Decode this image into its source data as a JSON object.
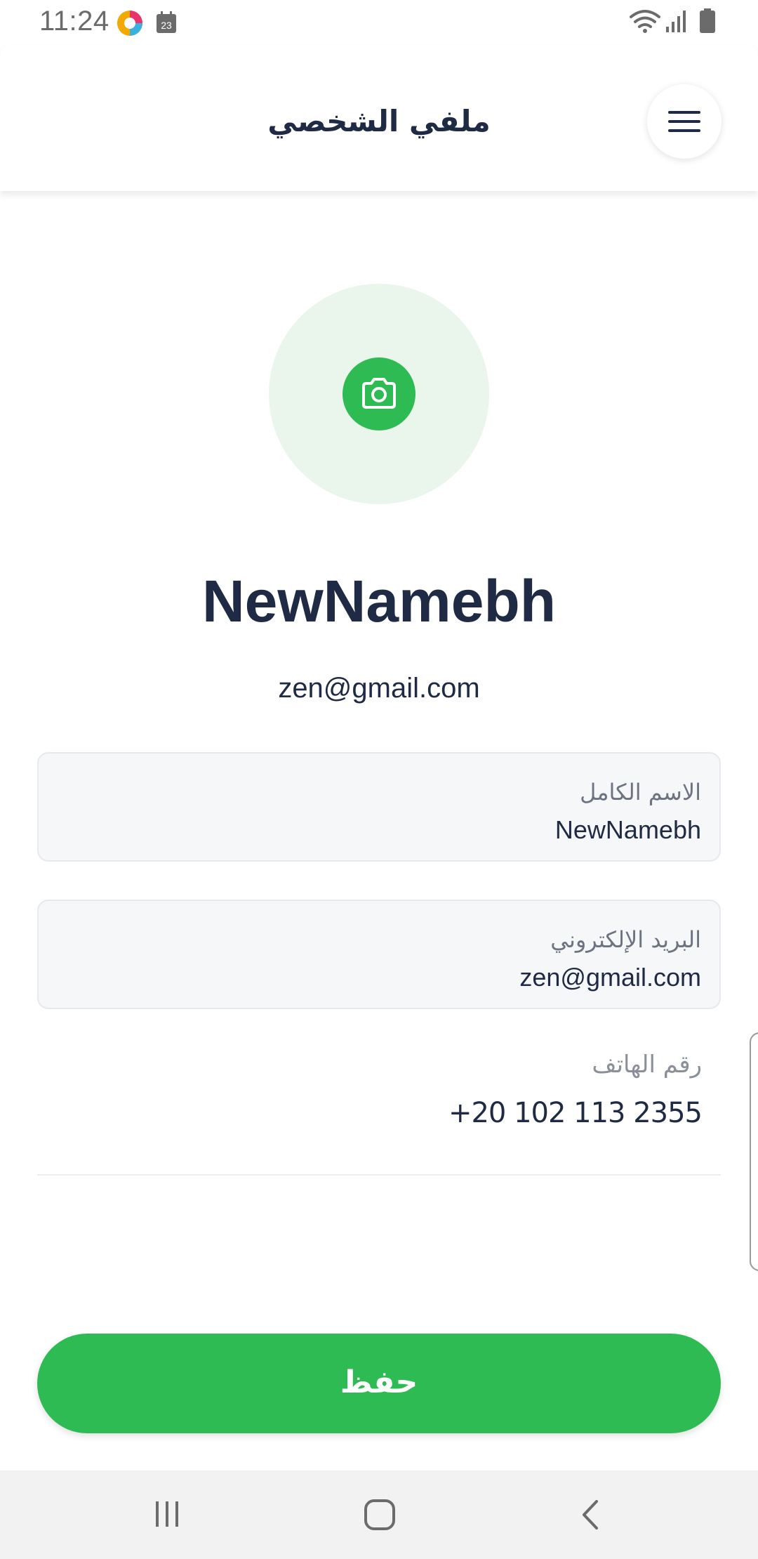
{
  "status_bar": {
    "time": "11:24",
    "calendar_day": "23"
  },
  "header": {
    "title": "ملفي الشخصي"
  },
  "profile": {
    "name": "NewNamebh",
    "email": "zen@gmail.com"
  },
  "fields": {
    "full_name": {
      "label": "الاسم الكامل",
      "value": "NewNamebh"
    },
    "email": {
      "label": "البريد الإلكتروني",
      "value": "zen@gmail.com"
    },
    "phone": {
      "label": "رقم الهاتف",
      "value": "+20 102 113 2355"
    }
  },
  "actions": {
    "save_label": "حفظ"
  },
  "colors": {
    "primary_green": "#2fbb54",
    "avatar_bg": "#eaf6ec",
    "text_dark": "#1f2a44",
    "field_bg": "#f6f7f9"
  },
  "icons": {
    "menu": "hamburger-icon",
    "camera": "camera-icon",
    "nav_recents": "recents-icon",
    "nav_home": "home-icon",
    "nav_back": "back-icon"
  }
}
